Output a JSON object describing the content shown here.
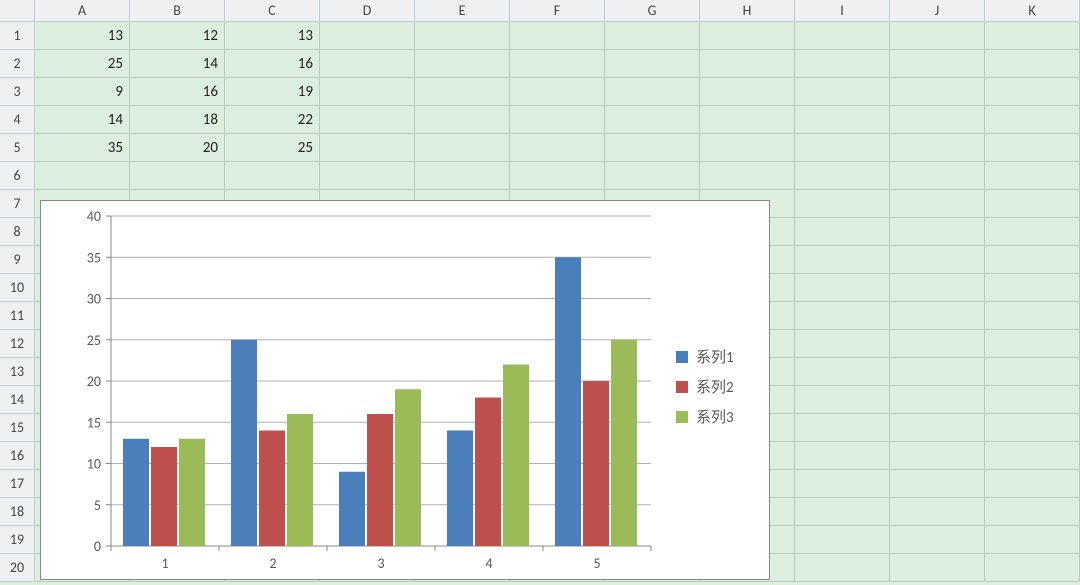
{
  "columns": [
    "A",
    "B",
    "C",
    "D",
    "E",
    "F",
    "G",
    "H",
    "I",
    "J",
    "K"
  ],
  "rows": [
    "1",
    "2",
    "3",
    "4",
    "5",
    "6",
    "7",
    "8",
    "9",
    "10",
    "11",
    "12",
    "13",
    "14",
    "15",
    "16",
    "17",
    "18",
    "19",
    "20"
  ],
  "table": [
    [
      13,
      12,
      13
    ],
    [
      25,
      14,
      16
    ],
    [
      9,
      16,
      19
    ],
    [
      14,
      18,
      22
    ],
    [
      35,
      20,
      25
    ]
  ],
  "legend": {
    "s1": "系列1",
    "s2": "系列2",
    "s3": "系列3"
  },
  "chart_data": {
    "type": "bar",
    "categories": [
      "1",
      "2",
      "3",
      "4",
      "5"
    ],
    "series": [
      {
        "name": "系列1",
        "color": "#4a7fbc",
        "values": [
          13,
          25,
          9,
          14,
          35
        ]
      },
      {
        "name": "系列2",
        "color": "#c0504d",
        "values": [
          12,
          14,
          16,
          18,
          20
        ]
      },
      {
        "name": "系列3",
        "color": "#9bbb59",
        "values": [
          13,
          16,
          19,
          22,
          25
        ]
      }
    ],
    "ylim": [
      0,
      40
    ],
    "yticks": [
      0,
      5,
      10,
      15,
      20,
      25,
      30,
      35,
      40
    ],
    "title": "",
    "xlabel": "",
    "ylabel": ""
  }
}
